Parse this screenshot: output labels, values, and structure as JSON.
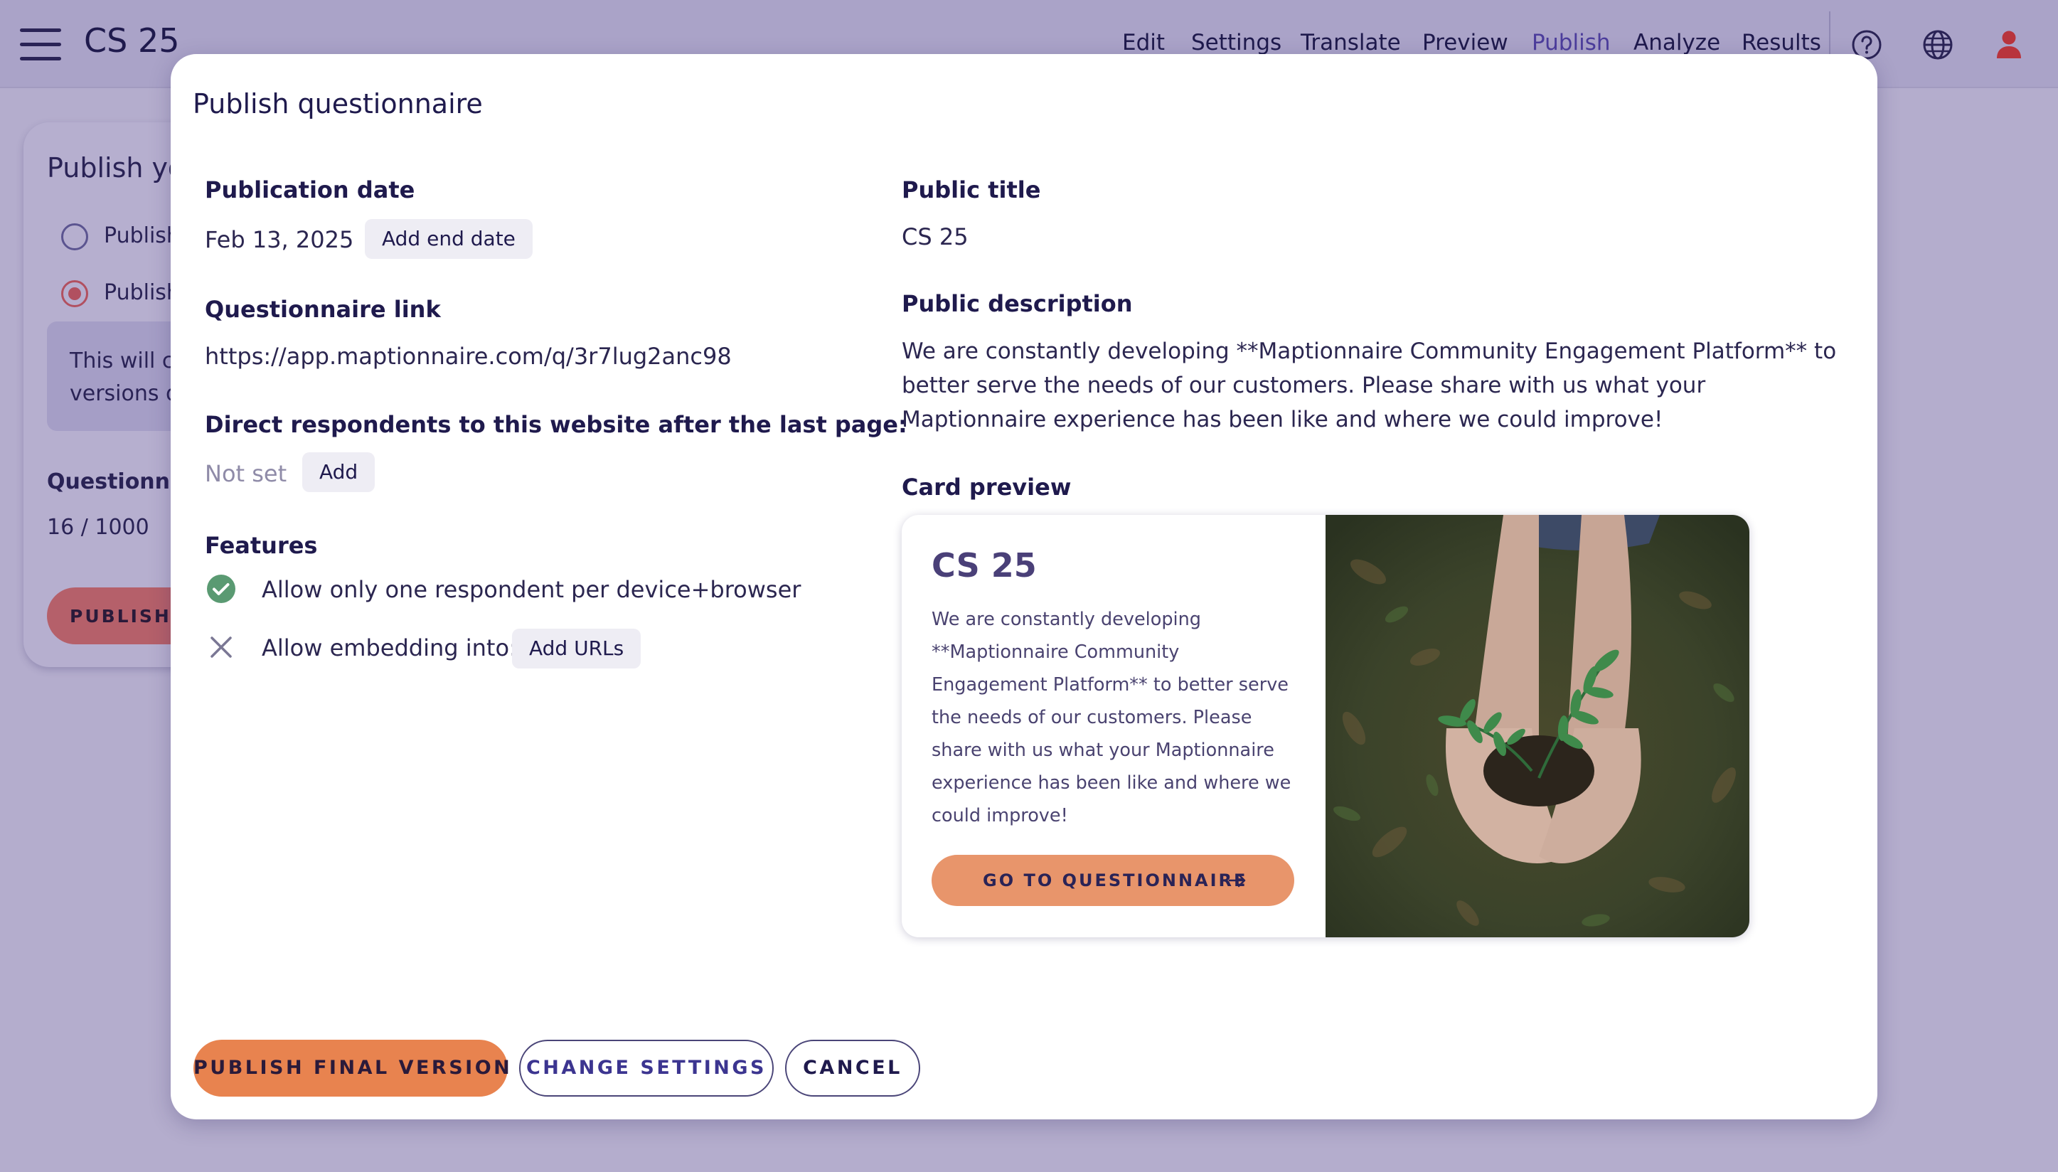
{
  "app": {
    "title": "CS 25",
    "nav": [
      "Edit",
      "Settings",
      "Translate",
      "Preview",
      "Publish",
      "Analyze",
      "Results"
    ],
    "active_nav": "Publish",
    "icons": [
      "menu-icon",
      "help-icon",
      "globe-icon",
      "user-icon"
    ]
  },
  "background_panel": {
    "heading": "Publish yo",
    "radio_1": "Publish",
    "radio_2": "Publish",
    "info_line_1": "This will c",
    "info_line_2": "versions o",
    "label": "Questionna",
    "count": "16 / 1000",
    "button": "PUBLISH F"
  },
  "modal": {
    "title": "Publish questionnaire",
    "publication_date": {
      "label": "Publication date",
      "value": "Feb 13, 2025",
      "add_end_date": "Add end date"
    },
    "questionnaire_link": {
      "label": "Questionnaire link",
      "value": "https://app.maptionnaire.com/q/3r7lug2anc98"
    },
    "redirect": {
      "label": "Direct respondents to this website after the last page:",
      "value": "Not set",
      "add": "Add"
    },
    "features": {
      "label": "Features",
      "one_respondent": "Allow only one respondent per device+browser",
      "one_respondent_enabled": true,
      "embedding": "Allow embedding into:",
      "embedding_enabled": false,
      "add_urls": "Add URLs"
    },
    "public_title": {
      "label": "Public title",
      "value": "CS 25"
    },
    "public_description": {
      "label": "Public description",
      "value": "We are constantly developing **Maptionnaire Community Engagement Platform** to better serve the needs of our customers. Please share with us what your Maptionnaire experience has been like and where we could improve!"
    },
    "card_preview": {
      "label": "Card preview",
      "title": "CS 25",
      "description": "We are constantly developing **Maptionnaire Community Engagement Platform** to better serve the needs of our customers. Please share with us what your Maptionnaire experience has been like and where we could improve!",
      "button": "GO TO QUESTIONNAIRE",
      "image": "hands-holding-seedling-photo"
    },
    "buttons": {
      "publish": "PUBLISH FINAL VERSION",
      "change_settings": "CHANGE SETTINGS",
      "cancel": "CANCEL"
    }
  },
  "colors": {
    "overlay": "#b4adcd",
    "accent_orange": "#e8834f",
    "primary_text": "#1f1a4d",
    "check_green": "#5a9a72"
  }
}
